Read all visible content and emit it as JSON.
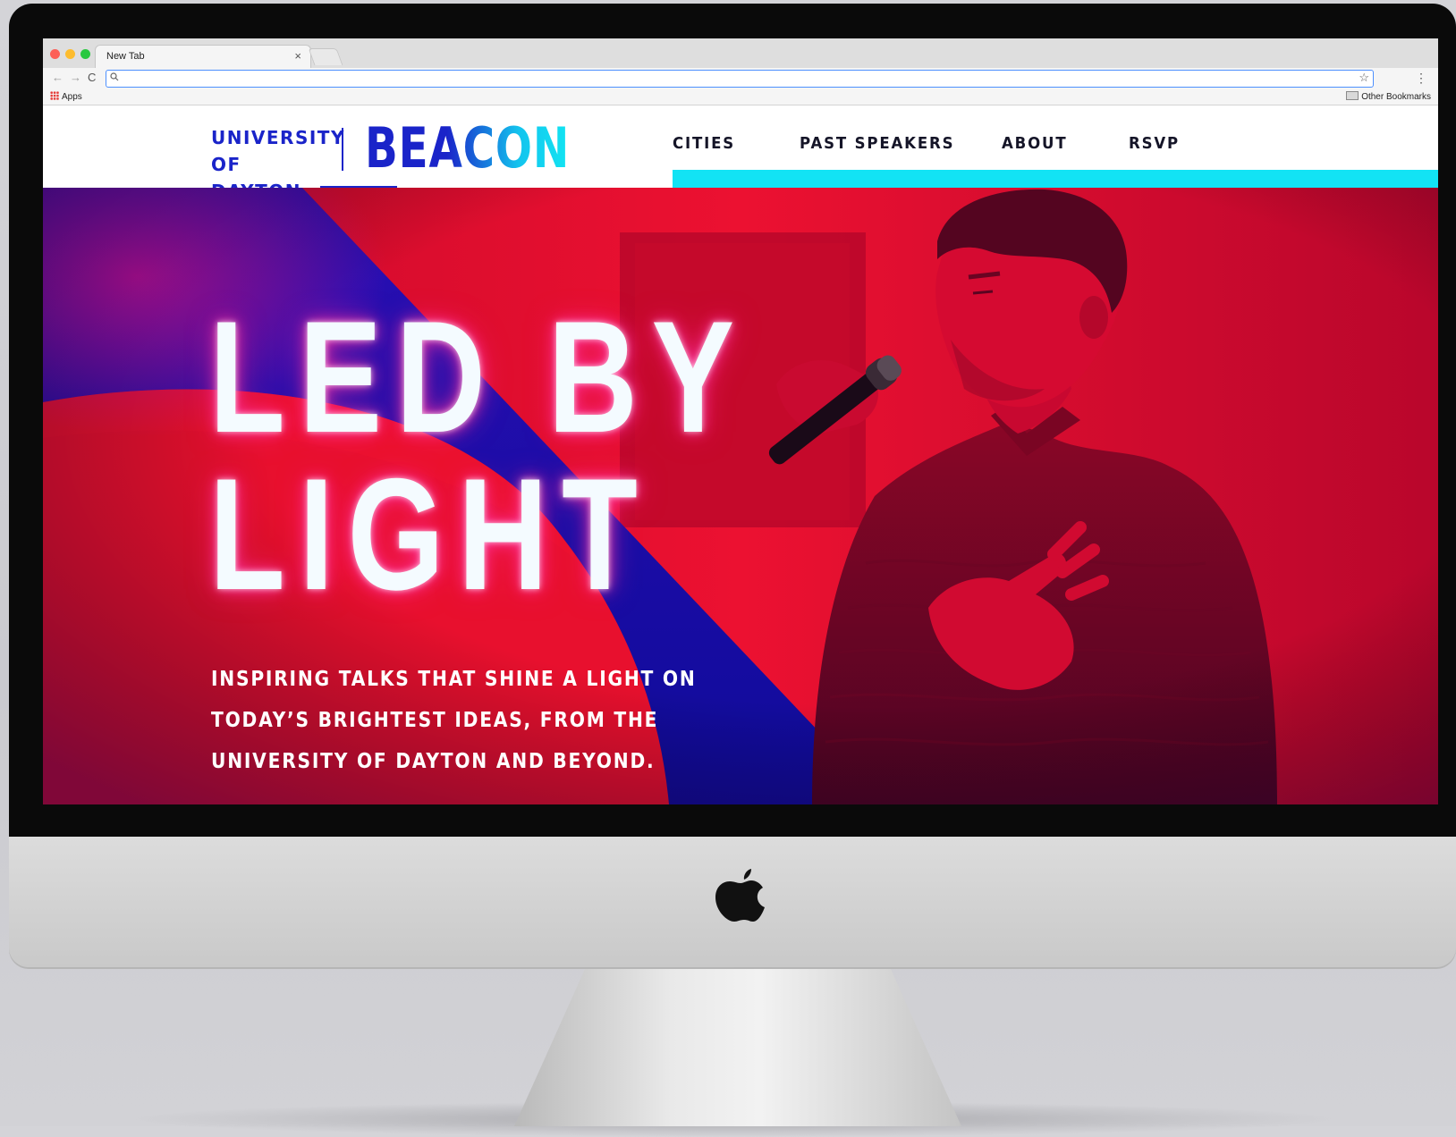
{
  "browser": {
    "tab_title": "New Tab",
    "tab_close": "×",
    "nav_back": "←",
    "nav_forward": "→",
    "nav_reload": "C",
    "address_value": "",
    "bookmarks": {
      "apps_label": "Apps",
      "other_label": "Other Bookmarks"
    }
  },
  "site": {
    "logo": {
      "line1": "UNIVERSITY",
      "line2": "OF DAYTON",
      "brand": "BEACON"
    },
    "nav": {
      "items": [
        {
          "label": "CITIES"
        },
        {
          "label": "PAST SPEAKERS"
        },
        {
          "label": "ABOUT"
        },
        {
          "label": "RSVP"
        }
      ]
    },
    "hero": {
      "title_line1": "LED BY",
      "title_line2": "LIGHT",
      "tagline": "INSPIRING TALKS THAT SHINE A LIGHT ON TODAY’S BRIGHTEST IDEAS, FROM THE UNIVERSITY OF DAYTON AND BEYOND."
    }
  },
  "colors": {
    "brand_blue": "#1a24c9",
    "accent_cyan": "#12e3f4",
    "hero_red": "#e3102f"
  },
  "icons": [
    "search-icon",
    "star-icon",
    "menu-dots-icon",
    "apps-grid-icon",
    "folder-icon",
    "apple-logo-icon"
  ]
}
